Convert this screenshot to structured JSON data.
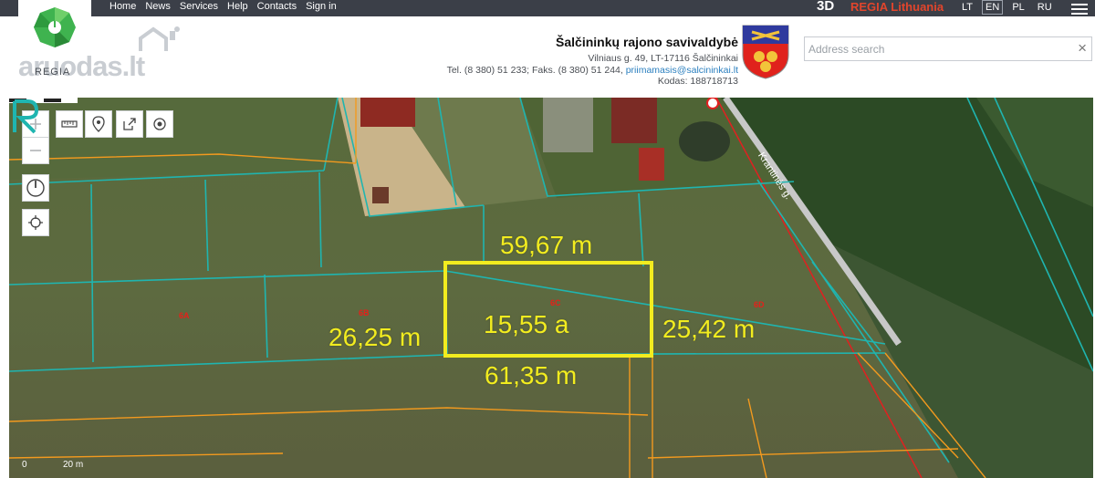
{
  "nav": {
    "items": [
      {
        "label": "Home"
      },
      {
        "label": "News"
      },
      {
        "label": "Services"
      },
      {
        "label": "Help"
      },
      {
        "label": "Contacts"
      },
      {
        "label": "Sign in"
      }
    ],
    "btn_3d": "3D",
    "regia_title": "REGIA Lithuania",
    "languages": [
      {
        "label": "LT",
        "active": false
      },
      {
        "label": "EN",
        "active": true
      },
      {
        "label": "PL",
        "active": false
      },
      {
        "label": "RU",
        "active": false
      }
    ]
  },
  "logo": {
    "wordmark": "aruodas.lt",
    "subtitle": "REGIA"
  },
  "municipality": {
    "name": "Šalčininkų rajono savivaldybė",
    "address": "Vilniaus g. 49, LT-17116 Šalčininkai",
    "phone_fax": "Tel. (8 380) 51 233; Faks. (8 380) 51 244, ",
    "email": "priimamasis@salcininkai.lt",
    "code": "Kodas: 188718713"
  },
  "search": {
    "placeholder": "Address search",
    "value": ""
  },
  "map": {
    "road_label": "Krantinės g.",
    "measurements": {
      "top": "59,67 m",
      "left": "26,25 m",
      "area": "15,55 a",
      "right": "25,42 m",
      "bottom": "61,35 m"
    },
    "parcel_labels": [
      "6A",
      "6B",
      "6C",
      "6D"
    ],
    "scale": {
      "zero": "0",
      "distance": "20 m"
    }
  },
  "colors": {
    "topbar": "#3b3f48",
    "accent_red": "#e2452c",
    "highlight_yellow": "#f2ec1f",
    "parcel_cyan": "#1fb5b0",
    "parcel_orange": "#f39a1e"
  }
}
